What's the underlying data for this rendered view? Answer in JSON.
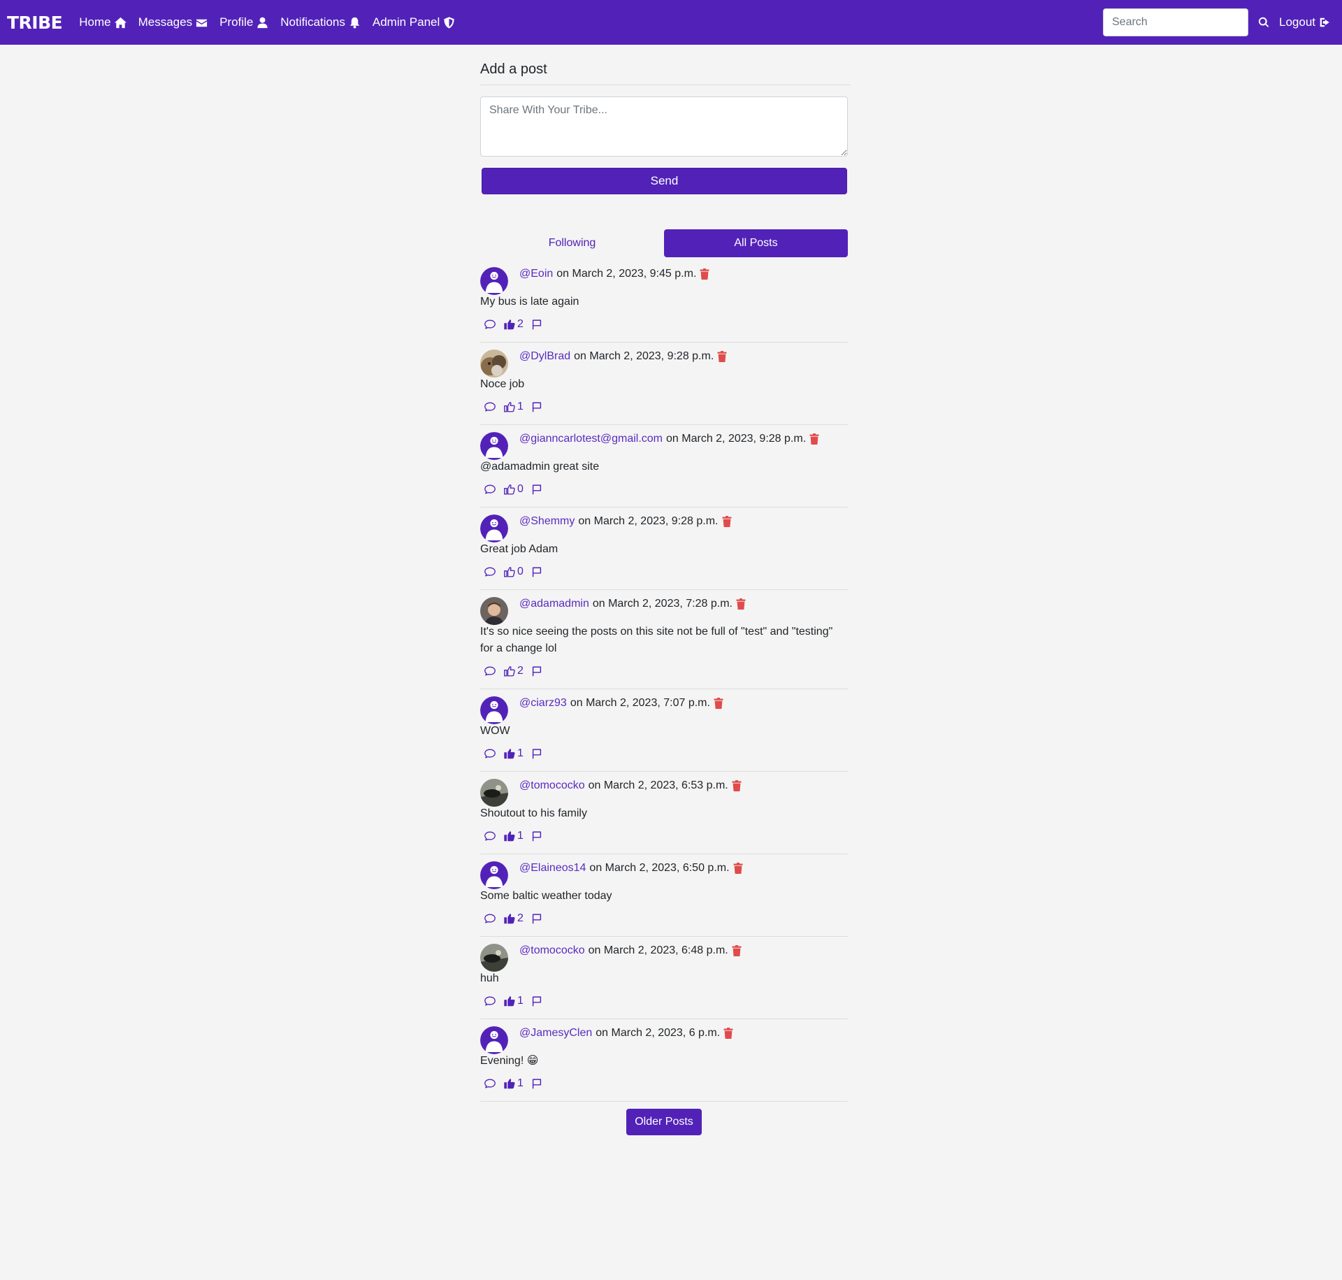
{
  "nav": {
    "brand": "TRIBE",
    "links": [
      {
        "label": "Home",
        "icon": "home-icon"
      },
      {
        "label": "Messages",
        "icon": "envelope-icon"
      },
      {
        "label": "Profile",
        "icon": "user-icon"
      },
      {
        "label": "Notifications",
        "icon": "bell-icon"
      },
      {
        "label": "Admin Panel",
        "icon": "shield-icon"
      }
    ],
    "search_placeholder": "Search",
    "logout_label": "Logout"
  },
  "compose": {
    "heading": "Add a post",
    "placeholder": "Share With Your Tribe...",
    "send_label": "Send"
  },
  "tabs": [
    {
      "label": "Following",
      "active": false
    },
    {
      "label": "All Posts",
      "active": true
    }
  ],
  "posts": [
    {
      "username": "@Eoin",
      "date": "on March 2, 2023, 9:45 p.m.",
      "body": "My bus is late again",
      "likes": "2",
      "liked": true,
      "avatar": "default"
    },
    {
      "username": "@DylBrad",
      "date": "on March 2, 2023, 9:28 p.m.",
      "body": "Noce job",
      "likes": "1",
      "liked": false,
      "avatar": "photo-dog"
    },
    {
      "username": "@gianncarlotest@gmail.com",
      "date": "on March 2, 2023, 9:28 p.m.",
      "body": "@adamadmin great site",
      "likes": "0",
      "liked": false,
      "avatar": "default"
    },
    {
      "username": "@Shemmy",
      "date": "on March 2, 2023, 9:28 p.m.",
      "body": "Great job Adam",
      "likes": "0",
      "liked": false,
      "avatar": "default"
    },
    {
      "username": "@adamadmin",
      "date": "on March 2, 2023, 7:28 p.m.",
      "body": "It's so nice seeing the posts on this site not be full of \"test\" and \"testing\" for a change lol",
      "likes": "2",
      "liked": false,
      "avatar": "photo-man"
    },
    {
      "username": "@ciarz93",
      "date": "on March 2, 2023, 7:07 p.m.",
      "body": "WOW",
      "likes": "1",
      "liked": true,
      "avatar": "default"
    },
    {
      "username": "@tomococko",
      "date": "on March 2, 2023, 6:53 p.m.",
      "body": "Shoutout to his family",
      "likes": "1",
      "liked": true,
      "avatar": "photo-car"
    },
    {
      "username": "@Elaineos14",
      "date": "on March 2, 2023, 6:50 p.m.",
      "body": "Some baltic weather today",
      "likes": "2",
      "liked": true,
      "avatar": "default"
    },
    {
      "username": "@tomococko",
      "date": "on March 2, 2023, 6:48 p.m.",
      "body": "huh",
      "likes": "1",
      "liked": true,
      "avatar": "photo-car"
    },
    {
      "username": "@JamesyClen",
      "date": "on March 2, 2023, 6 p.m.",
      "body": "Evening! 😁",
      "likes": "1",
      "liked": true,
      "avatar": "default"
    }
  ],
  "older_label": "Older Posts",
  "colors": {
    "accent": "#5222b8",
    "danger": "#e04b4b",
    "background": "#f4f4f4"
  }
}
